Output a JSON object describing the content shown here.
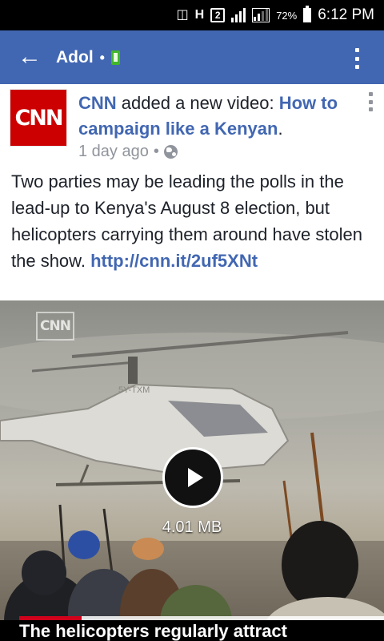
{
  "status_bar": {
    "battery_percent": "72%",
    "time": "6:12 PM",
    "network_type": "H",
    "sim_slot": "2",
    "icons": [
      "nfc-mute-icon",
      "network-h-icon",
      "sim-2-icon",
      "signal-icon",
      "signal-2-icon",
      "battery-icon"
    ]
  },
  "app_bar": {
    "title": "Adol",
    "separator": "•",
    "icons": [
      "back-arrow-icon",
      "mobile-active-icon",
      "overflow-menu-icon"
    ],
    "back_glyph": "←",
    "accent_color": "#4267b2"
  },
  "post": {
    "page_name": "CNN",
    "logo_text": "CNN",
    "action_text": " added a new video: ",
    "video_title": "How to campaign like a Kenyan",
    "trailing": ".",
    "time": "1 day ago",
    "meta_separator": "•",
    "privacy_icon": "globe-icon",
    "body": "Two parties may be leading the polls in the lead-up to Kenya's August 8 election, but helicopters carrying them around have stolen the show. ",
    "link": "http://cnn.it/2uf5XNt",
    "link_color": "#4267b2"
  },
  "video": {
    "watermark": "CNN",
    "registration": "5Y-TXM",
    "file_size": "4.01 MB",
    "caption": "The helicopters regularly attract",
    "progress": 0.17,
    "progress_color": "#d0021b"
  }
}
